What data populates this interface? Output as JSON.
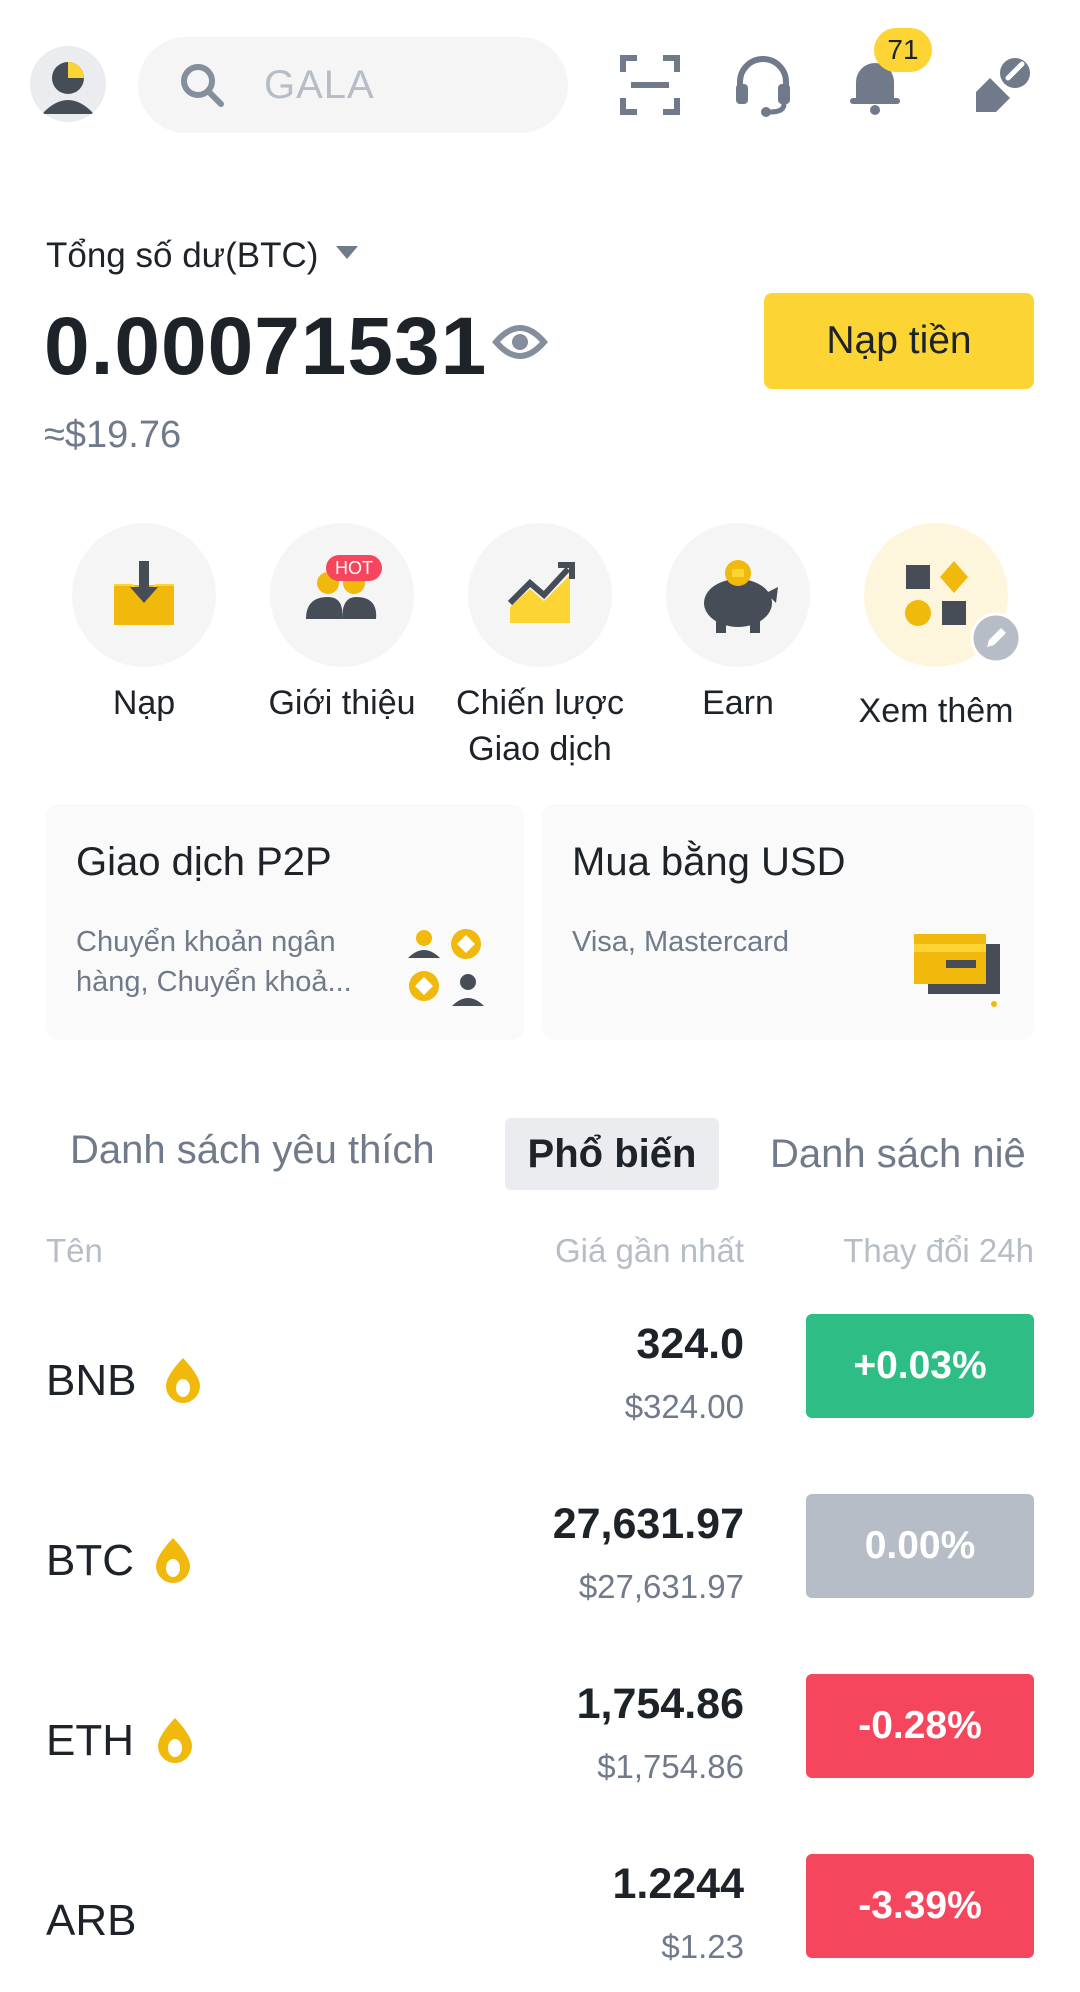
{
  "header": {
    "search_placeholder": "GALA",
    "notification_count": "71",
    "icons": [
      "avatar",
      "search-icon",
      "scan-icon",
      "support-headset-icon",
      "bell-icon",
      "edit-icon"
    ]
  },
  "balance": {
    "label": "Tổng số dư(BTC)",
    "value": "0.00071531",
    "usd": "≈$19.76",
    "deposit_button": "Nạp tiền"
  },
  "shortcuts": [
    {
      "label": "Nạp",
      "icon": "deposit-icon"
    },
    {
      "label": "Giới thiệu",
      "icon": "referral-icon",
      "badge": "HOT"
    },
    {
      "label": "Chiến lược",
      "label2": "Giao dịch",
      "icon": "strategy-chart-icon"
    },
    {
      "label": "Earn",
      "icon": "piggy-bank-icon"
    },
    {
      "label": "Xem thêm",
      "icon": "more-apps-icon"
    }
  ],
  "cards": [
    {
      "title": "Giao dịch P2P",
      "subtitle": "Chuyển khoản ngân hàng, Chuyển khoả..."
    },
    {
      "title": "Mua bằng USD",
      "subtitle": "Visa, Mastercard"
    }
  ],
  "tabs": [
    "Danh sách yêu thích",
    "Phổ biến",
    "Danh sách niê"
  ],
  "table": {
    "headers": {
      "name": "Tên",
      "price": "Giá gần nhất",
      "change": "Thay đổi 24h"
    },
    "rows": [
      {
        "symbol": "BNB",
        "price": "324.0",
        "fiat": "$324.00",
        "change": "+0.03%",
        "status": "up"
      },
      {
        "symbol": "BTC",
        "price": "27,631.97",
        "fiat": "$27,631.97",
        "change": "0.00%",
        "status": "flat"
      },
      {
        "symbol": "ETH",
        "price": "1,754.86",
        "fiat": "$1,754.86",
        "change": "-0.28%",
        "status": "down"
      },
      {
        "symbol": "ARB",
        "price": "1.2244",
        "fiat": "$1.23",
        "change": "-3.39%",
        "status": "down"
      }
    ]
  },
  "colors": {
    "brand_yellow": "#fcd535",
    "up_green": "#2ebd85",
    "down_red": "#f6465d",
    "flat_gray": "#b7bdc6"
  }
}
